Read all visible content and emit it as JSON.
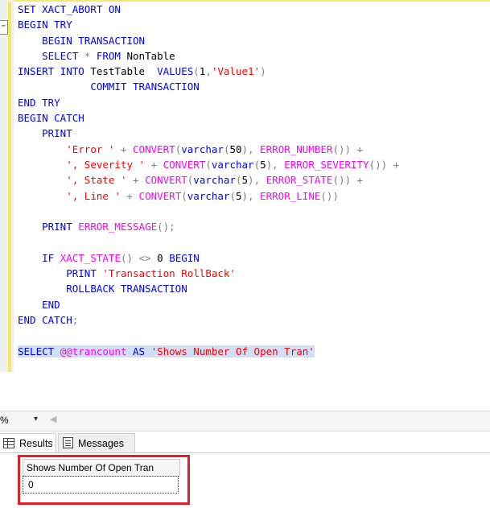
{
  "editor": {
    "lines": [
      [
        {
          "t": "SET XACT_ABORT ON",
          "c": "kw"
        }
      ],
      [
        {
          "t": "BEGIN TRY",
          "c": "kw"
        }
      ],
      [
        {
          "t": "    "
        },
        {
          "t": "BEGIN TRANSACTION",
          "c": "kw"
        }
      ],
      [
        {
          "t": "    "
        },
        {
          "t": "SELECT",
          "c": "kw"
        },
        {
          "t": " "
        },
        {
          "t": "*",
          "c": "op"
        },
        {
          "t": " "
        },
        {
          "t": "FROM",
          "c": "kw"
        },
        {
          "t": " NonTable"
        }
      ],
      [
        {
          "t": "INSERT INTO",
          "c": "kw"
        },
        {
          "t": " TestTable  "
        },
        {
          "t": "VALUES",
          "c": "kw"
        },
        {
          "t": "(",
          "c": "op"
        },
        {
          "t": "1"
        },
        {
          "t": ",",
          "c": "op"
        },
        {
          "t": "'Value1'",
          "c": "str"
        },
        {
          "t": ")",
          "c": "op"
        }
      ],
      [
        {
          "t": "            "
        },
        {
          "t": "COMMIT TRANSACTION",
          "c": "kw"
        }
      ],
      [
        {
          "t": "END TRY",
          "c": "kw"
        }
      ],
      [
        {
          "t": "BEGIN CATCH",
          "c": "kw"
        }
      ],
      [
        {
          "t": "    "
        },
        {
          "t": "PRINT",
          "c": "kw"
        }
      ],
      [
        {
          "t": "        "
        },
        {
          "t": "'Error '",
          "c": "str"
        },
        {
          "t": " "
        },
        {
          "t": "+",
          "c": "op"
        },
        {
          "t": " "
        },
        {
          "t": "CONVERT",
          "c": "fn"
        },
        {
          "t": "(",
          "c": "op"
        },
        {
          "t": "varchar",
          "c": "kw"
        },
        {
          "t": "(",
          "c": "op"
        },
        {
          "t": "50"
        },
        {
          "t": "),",
          "c": "op"
        },
        {
          "t": " "
        },
        {
          "t": "ERROR_NUMBER",
          "c": "fn"
        },
        {
          "t": "())",
          "c": "op"
        },
        {
          "t": " "
        },
        {
          "t": "+",
          "c": "op"
        }
      ],
      [
        {
          "t": "        "
        },
        {
          "t": "', Severity '",
          "c": "str"
        },
        {
          "t": " "
        },
        {
          "t": "+",
          "c": "op"
        },
        {
          "t": " "
        },
        {
          "t": "CONVERT",
          "c": "fn"
        },
        {
          "t": "(",
          "c": "op"
        },
        {
          "t": "varchar",
          "c": "kw"
        },
        {
          "t": "(",
          "c": "op"
        },
        {
          "t": "5"
        },
        {
          "t": "),",
          "c": "op"
        },
        {
          "t": " "
        },
        {
          "t": "ERROR_SEVERITY",
          "c": "fn"
        },
        {
          "t": "())",
          "c": "op"
        },
        {
          "t": " "
        },
        {
          "t": "+",
          "c": "op"
        }
      ],
      [
        {
          "t": "        "
        },
        {
          "t": "', State '",
          "c": "str"
        },
        {
          "t": " "
        },
        {
          "t": "+",
          "c": "op"
        },
        {
          "t": " "
        },
        {
          "t": "CONVERT",
          "c": "fn"
        },
        {
          "t": "(",
          "c": "op"
        },
        {
          "t": "varchar",
          "c": "kw"
        },
        {
          "t": "(",
          "c": "op"
        },
        {
          "t": "5"
        },
        {
          "t": "),",
          "c": "op"
        },
        {
          "t": " "
        },
        {
          "t": "ERROR_STATE",
          "c": "fn"
        },
        {
          "t": "())",
          "c": "op"
        },
        {
          "t": " "
        },
        {
          "t": "+",
          "c": "op"
        }
      ],
      [
        {
          "t": "        "
        },
        {
          "t": "', Line '",
          "c": "str"
        },
        {
          "t": " "
        },
        {
          "t": "+",
          "c": "op"
        },
        {
          "t": " "
        },
        {
          "t": "CONVERT",
          "c": "fn"
        },
        {
          "t": "(",
          "c": "op"
        },
        {
          "t": "varchar",
          "c": "kw"
        },
        {
          "t": "(",
          "c": "op"
        },
        {
          "t": "5"
        },
        {
          "t": "),",
          "c": "op"
        },
        {
          "t": " "
        },
        {
          "t": "ERROR_LINE",
          "c": "fn"
        },
        {
          "t": "())",
          "c": "op"
        }
      ],
      [],
      [
        {
          "t": "    "
        },
        {
          "t": "PRINT",
          "c": "kw"
        },
        {
          "t": " "
        },
        {
          "t": "ERROR_MESSAGE",
          "c": "fn"
        },
        {
          "t": "();",
          "c": "op"
        }
      ],
      [],
      [
        {
          "t": "    "
        },
        {
          "t": "IF",
          "c": "kw"
        },
        {
          "t": " "
        },
        {
          "t": "XACT_STATE",
          "c": "fn"
        },
        {
          "t": "()",
          "c": "op"
        },
        {
          "t": " "
        },
        {
          "t": "<>",
          "c": "op"
        },
        {
          "t": " 0 "
        },
        {
          "t": "BEGIN",
          "c": "kw"
        }
      ],
      [
        {
          "t": "        "
        },
        {
          "t": "PRINT",
          "c": "kw"
        },
        {
          "t": " "
        },
        {
          "t": "'Transaction RollBack'",
          "c": "str"
        }
      ],
      [
        {
          "t": "        "
        },
        {
          "t": "ROLLBACK TRANSACTION",
          "c": "kw"
        }
      ],
      [
        {
          "t": "    "
        },
        {
          "t": "END",
          "c": "kw"
        }
      ],
      [
        {
          "t": "END CATCH",
          "c": "kw"
        },
        {
          "t": ";",
          "c": "op"
        }
      ],
      [],
      [
        {
          "t": "SELECT",
          "c": "kw sel"
        },
        {
          "t": " ",
          "c": "sel"
        },
        {
          "t": "@@trancount",
          "c": "fn sel"
        },
        {
          "t": " ",
          "c": "sel"
        },
        {
          "t": "AS",
          "c": "kw sel"
        },
        {
          "t": " ",
          "c": "sel"
        },
        {
          "t": "'Shows Number Of Open Tran'",
          "c": "str sel"
        }
      ]
    ],
    "collapse_symbol": "−"
  },
  "zoom": {
    "value": "%",
    "arrow": "▾",
    "scroll_left": "◀"
  },
  "tabs": {
    "results": "Results",
    "messages": "Messages"
  },
  "grid": {
    "column_header": "Shows Number Of Open Tran",
    "row_value": "0"
  },
  "colors": {
    "keyword": "#0000ff",
    "function": "#ff00ff",
    "string": "#ff0000",
    "operator": "#808080",
    "highlight_box": "#e41e26"
  }
}
